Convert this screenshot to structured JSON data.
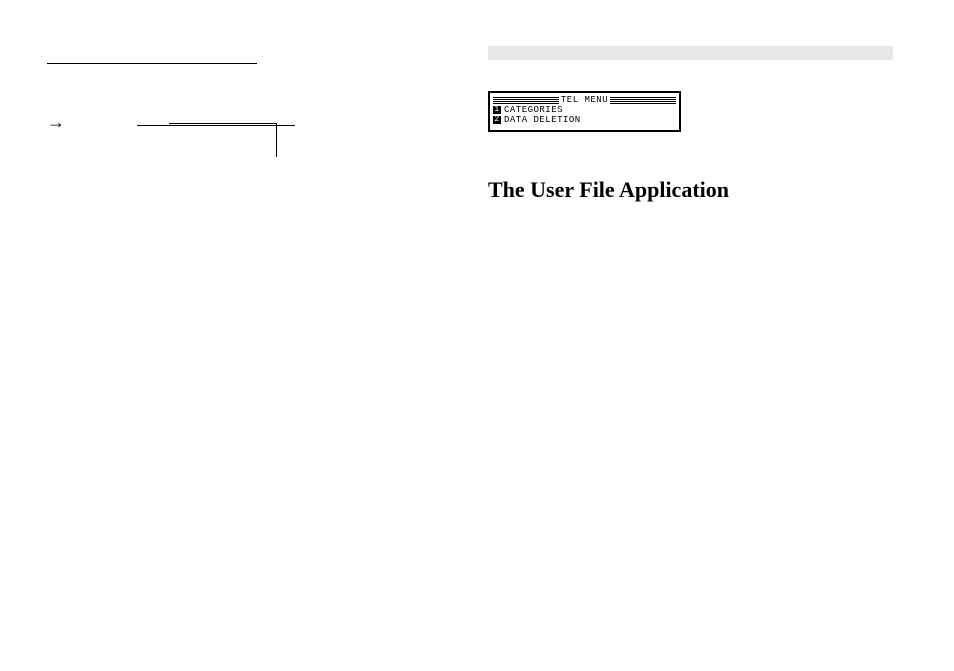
{
  "left": {
    "arrow": "→"
  },
  "lcd": {
    "title": "TEL MENU",
    "items": [
      {
        "num": "1",
        "label": "CATEGORIES"
      },
      {
        "num": "2",
        "label": "DATA DELETION"
      }
    ]
  },
  "heading": "The User File Application"
}
